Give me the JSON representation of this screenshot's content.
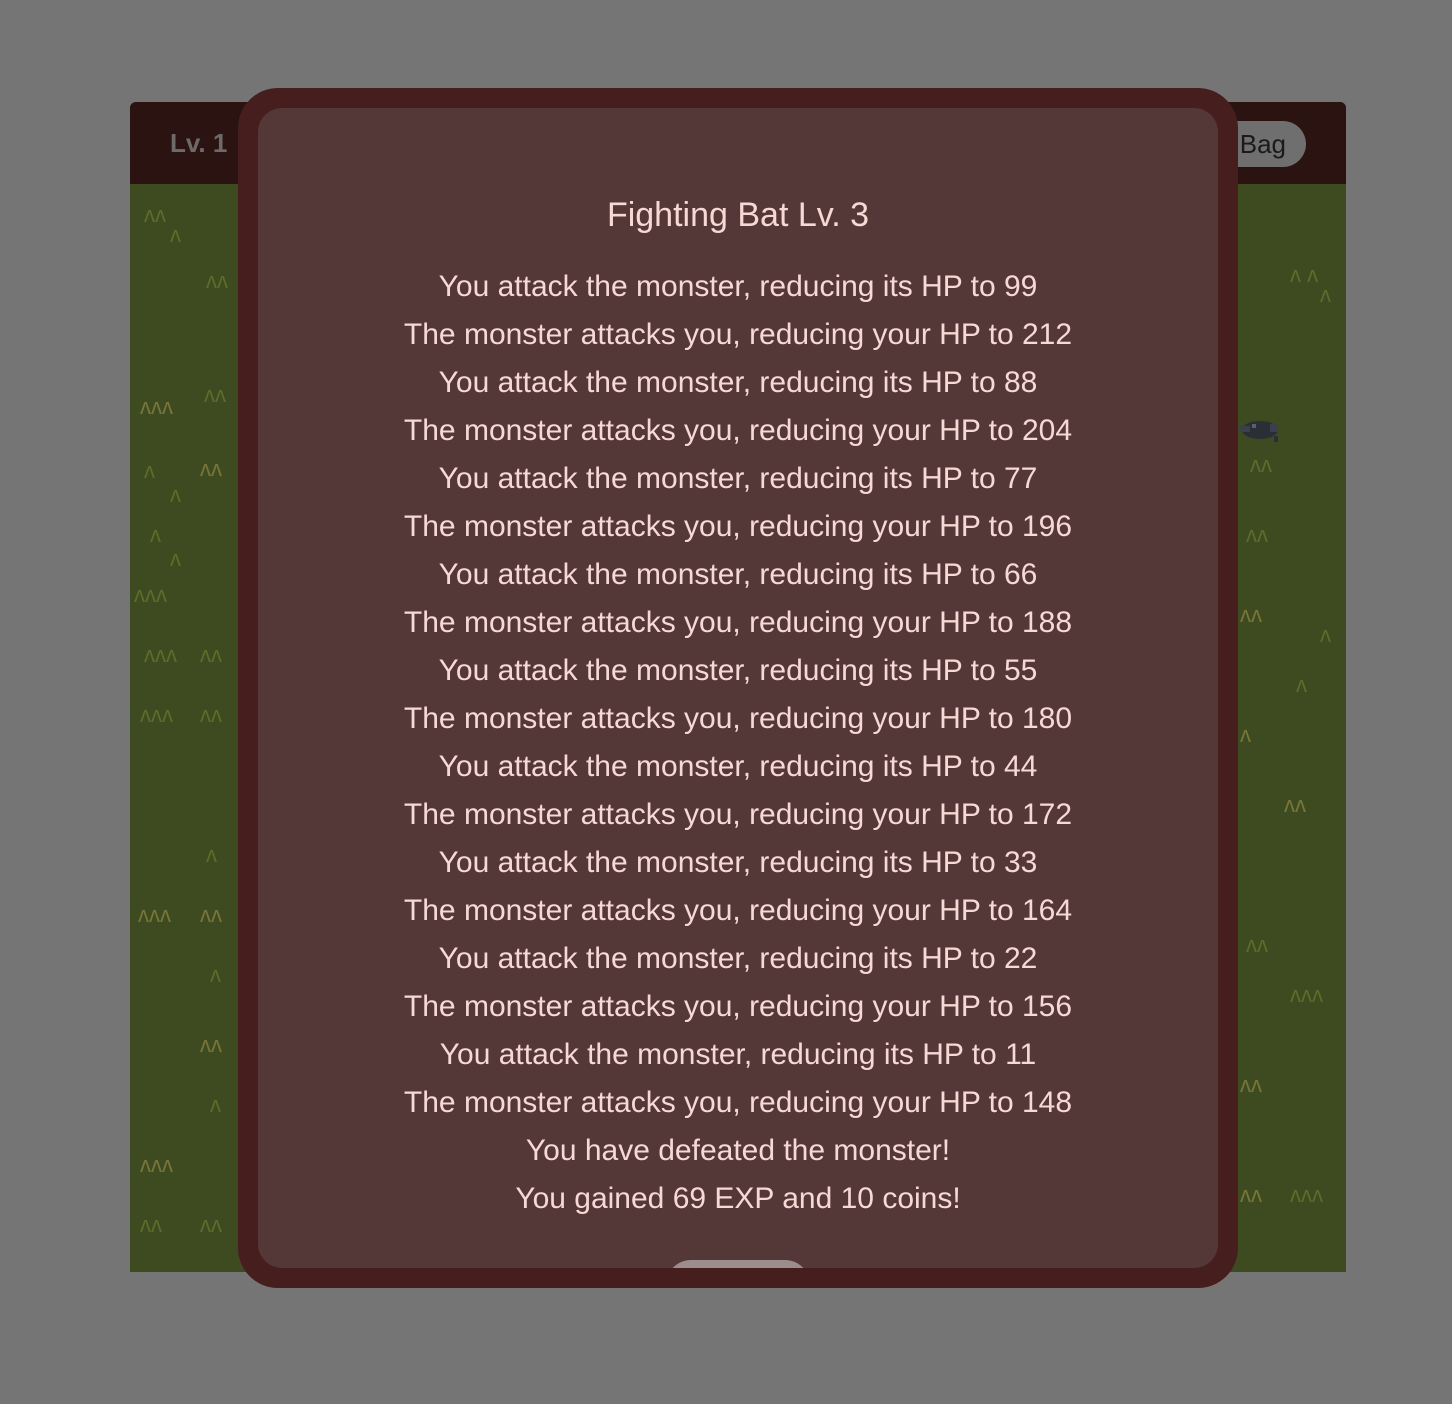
{
  "header": {
    "level": "Lv. 1",
    "bag_label": "Bag"
  },
  "battle": {
    "title": "Fighting Bat Lv. 3",
    "log": [
      "You attack the monster, reducing its HP to 99",
      "The monster attacks you, reducing your HP to 212",
      "You attack the monster, reducing its HP to 88",
      "The monster attacks you, reducing your HP to 204",
      "You attack the monster, reducing its HP to 77",
      "The monster attacks you, reducing your HP to 196",
      "You attack the monster, reducing its HP to 66",
      "The monster attacks you, reducing your HP to 188",
      "You attack the monster, reducing its HP to 55",
      "The monster attacks you, reducing your HP to 180",
      "You attack the monster, reducing its HP to 44",
      "The monster attacks you, reducing your HP to 172",
      "You attack the monster, reducing its HP to 33",
      "The monster attacks you, reducing your HP to 164",
      "You attack the monster, reducing its HP to 22",
      "The monster attacks you, reducing your HP to 156",
      "You attack the monster, reducing its HP to 11",
      "The monster attacks you, reducing your HP to 148",
      "You have defeated the monster!",
      "You gained 69 EXP and 10 coins!"
    ]
  },
  "icons": {
    "grass": "grass-tuft-icon",
    "bat": "bat-sprite-icon"
  },
  "colors": {
    "overlay": "#757575",
    "modal_border": "#471e1e",
    "modal_fill": "#543737",
    "text": "#f7d8d4",
    "grass_field": "#3e4a1f"
  }
}
